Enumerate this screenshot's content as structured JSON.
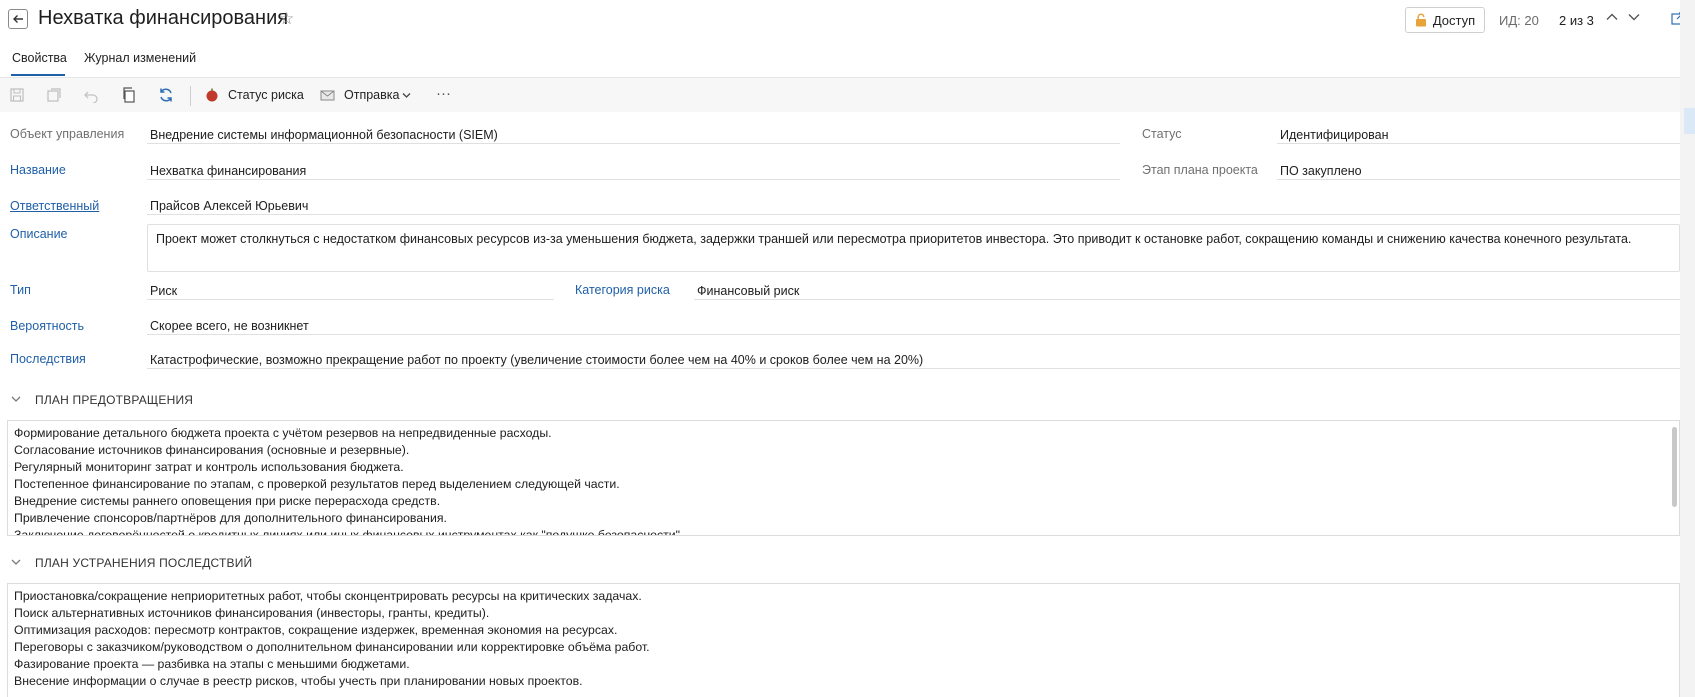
{
  "header": {
    "title": "Нехватка финансирования",
    "access_label": "Доступ",
    "id_text": "ИД: 20",
    "nav_count": "2 из 3"
  },
  "tabs": [
    {
      "label": "Свойства",
      "active": true
    },
    {
      "label": "Журнал изменений",
      "active": false
    }
  ],
  "toolbar": {
    "risk_status_label": "Статус риска",
    "send_label": "Отправка",
    "more_label": "···"
  },
  "form": {
    "object_label": "Объект управления",
    "object_value": "Внедрение системы информационной безопасности (SIEM)",
    "status_label": "Статус",
    "status_value": "Идентифицирован",
    "name_label": "Название",
    "name_value": "Нехватка финансирования",
    "stage_label": "Этап плана проекта",
    "stage_value": "ПО закуплено",
    "responsible_label": "Ответственный",
    "responsible_value": "Прайсов Алексей Юрьевич",
    "description_label": "Описание",
    "description_value": "Проект может столкнуться с недостатком финансовых ресурсов из-за уменьшения бюджета, задержки траншей или пересмотра приоритетов инвестора. Это приводит к остановке работ, сокращению команды и снижению качества конечного результата.",
    "type_label": "Тип",
    "type_value": "Риск",
    "category_label": "Категория риска",
    "category_value": "Финансовый риск",
    "probability_label": "Вероятность",
    "probability_value": "Скорее всего, не возникнет",
    "consequences_label": "Последствия",
    "consequences_value": "Катастрофические, возможно прекращение работ по проекту (увеличение стоимости более чем на 40% и сроков более чем на 20%)"
  },
  "prevention": {
    "title": "ПЛАН ПРЕДОТВРАЩЕНИЯ",
    "lines": [
      "Формирование детального бюджета проекта с учётом резервов на непредвиденные расходы.",
      "Согласование источников финансирования (основные и резервные).",
      "Регулярный мониторинг затрат и контроль использования бюджета.",
      "Постепенное финансирование по этапам, с проверкой результатов перед выделением следующей части.",
      "Внедрение системы раннего оповещения при риске перерасхода средств.",
      "Привлечение спонсоров/партнёров для дополнительного финансирования.",
      "Заключение договорённостей о кредитных линиях или иных финансовых инструментах как \"подушке безопасности\"."
    ]
  },
  "mitigation": {
    "title": "ПЛАН УСТРАНЕНИЯ ПОСЛЕДСТВИЙ",
    "lines": [
      "Приостановка/сокращение неприоритетных работ, чтобы сконцентрировать ресурсы на критических задачах.",
      "Поиск альтернативных источников финансирования (инвесторы, гранты, кредиты).",
      "Оптимизация расходов: пересмотр контрактов, сокращение издержек, временная экономия на ресурсах.",
      "Переговоры с заказчиком/руководством о дополнительном финансировании или корректировке объёма работ.",
      "Фазирование проекта — разбивка на этапы с меньшими бюджетами.",
      "Внесение информации о случае в реестр рисков, чтобы учесть при планировании новых проектов."
    ]
  }
}
